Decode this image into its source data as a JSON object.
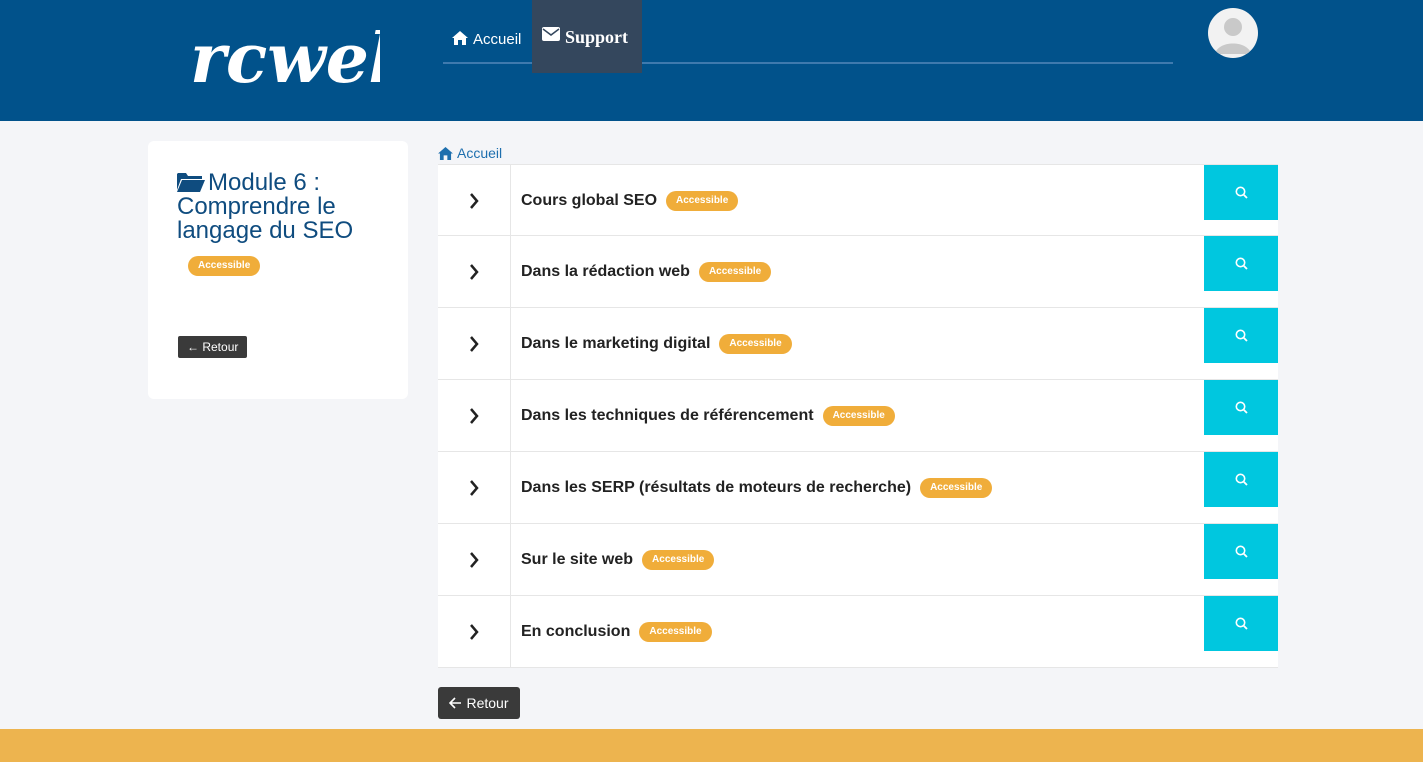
{
  "header": {
    "logo_text": "rcweb",
    "nav": [
      {
        "label": "Accueil",
        "icon": "home-icon"
      },
      {
        "label": "Support",
        "icon": "envelope-icon"
      }
    ],
    "avatar_icon": "user-avatar-icon"
  },
  "sidebar": {
    "title": "Module 6 : Comprendre le langage du SEO",
    "title_icon": "folder-open-icon",
    "badge": "Accessible",
    "back_label": "Retour"
  },
  "breadcrumb": {
    "label": "Accueil",
    "icon": "home-icon"
  },
  "lessons": [
    {
      "title": "Cours global SEO",
      "badge": "Accessible"
    },
    {
      "title": "Dans la rédaction web",
      "badge": "Accessible"
    },
    {
      "title": "Dans le marketing digital",
      "badge": "Accessible"
    },
    {
      "title": "Dans les techniques de référencement",
      "badge": "Accessible"
    },
    {
      "title": "Dans les SERP (résultats de moteurs de recherche)",
      "badge": "Accessible"
    },
    {
      "title": "Sur le site web",
      "badge": "Accessible"
    },
    {
      "title": "En conclusion",
      "badge": "Accessible"
    }
  ],
  "back_button": {
    "label": "Retour"
  },
  "colors": {
    "header": "#01528b",
    "support_tab": "#34475d",
    "badge": "#f0ad3a",
    "search_button": "#00c7df",
    "footer": "#edb44f",
    "title": "#0f4c7f"
  }
}
